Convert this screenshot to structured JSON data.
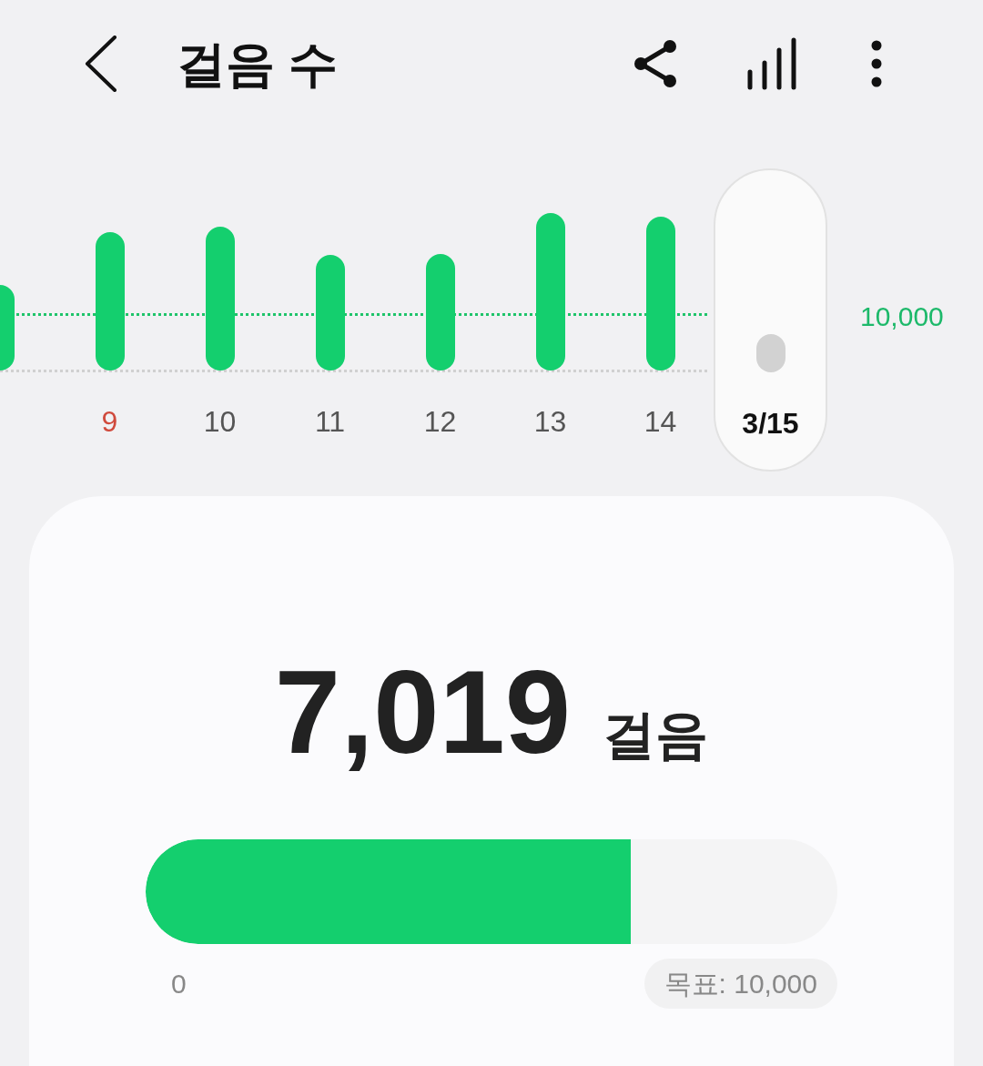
{
  "header": {
    "title": "걸음 수"
  },
  "chart": {
    "goal_label": "10,000",
    "days": [
      {
        "label": "9",
        "selected": false,
        "color": "#d04a3c"
      },
      {
        "label": "10",
        "selected": false,
        "color": "#555555"
      },
      {
        "label": "11",
        "selected": false,
        "color": "#555555"
      },
      {
        "label": "12",
        "selected": false,
        "color": "#555555"
      },
      {
        "label": "13",
        "selected": false,
        "color": "#555555"
      },
      {
        "label": "14",
        "selected": false,
        "color": "#555555"
      },
      {
        "label": "3/15",
        "selected": true,
        "color": "#111111"
      }
    ]
  },
  "summary": {
    "steps": "7,019",
    "unit": "걸음"
  },
  "progress": {
    "level": 0.7019,
    "start_label": "0",
    "goal_label": "목표: 10,000"
  }
}
